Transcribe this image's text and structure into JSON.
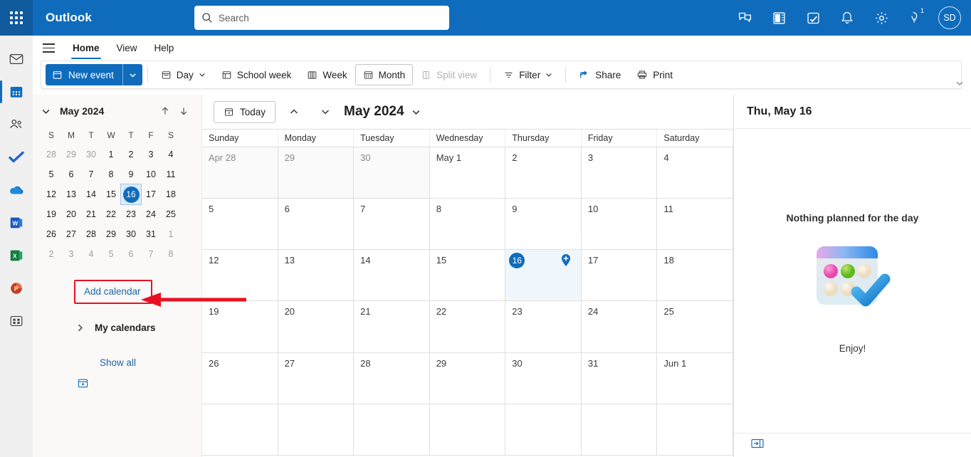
{
  "topbar": {
    "app_grid_icon": "waffle-icon",
    "brand": "Outlook",
    "search_placeholder": "Search",
    "search_value": "",
    "search_icon": "search-icon",
    "icons": [
      {
        "name": "teams-chat-icon",
        "label": "Chat"
      },
      {
        "name": "onenote-icon",
        "label": "OneNote"
      },
      {
        "name": "notes-icon",
        "label": "Notes"
      },
      {
        "name": "bell-icon",
        "label": "Notifications"
      },
      {
        "name": "gear-icon",
        "label": "Settings"
      },
      {
        "name": "feedback-icon",
        "label": "Feedback"
      }
    ],
    "feedback_badge": "1",
    "avatar_initials": "SD",
    "bg_color": "#0f6cbd"
  },
  "rail": {
    "items": [
      {
        "name": "rail-item-mail",
        "label": "Mail",
        "active": false
      },
      {
        "name": "rail-item-calendar",
        "label": "Calendar",
        "active": true
      },
      {
        "name": "rail-item-people",
        "label": "People",
        "active": false
      },
      {
        "name": "rail-item-todo",
        "label": "To Do",
        "active": false
      },
      {
        "name": "rail-item-onedrive",
        "label": "OneDrive",
        "active": false
      },
      {
        "name": "rail-item-word",
        "label": "Word",
        "active": false
      },
      {
        "name": "rail-item-excel",
        "label": "Excel",
        "active": false
      },
      {
        "name": "rail-item-powerpoint",
        "label": "PowerPoint",
        "active": false
      },
      {
        "name": "rail-item-apps",
        "label": "More apps",
        "active": false
      }
    ]
  },
  "tabs": {
    "hamburger_icon": "hamburger-icon",
    "items": [
      {
        "label": "Home",
        "active": true
      },
      {
        "label": "View",
        "active": false
      },
      {
        "label": "Help",
        "active": false
      }
    ]
  },
  "toolbar": {
    "new_event_label": "New event",
    "new_event_caret": "chevron-down-icon",
    "day_label": "Day",
    "school_week_label": "School week",
    "week_label": "Week",
    "month_label": "Month",
    "split_view_label": "Split view",
    "filter_label": "Filter",
    "share_label": "Share",
    "print_label": "Print",
    "ribbon_expand_icon": "chevron-down-icon",
    "selected": "Month",
    "disabled": "Split view"
  },
  "left_pane": {
    "mini_calendar": {
      "title": "May 2024",
      "collapse_icon": "chevron-down-icon",
      "prev_icon": "arrow-up-icon",
      "next_icon": "arrow-down-icon",
      "day_initials": [
        "S",
        "M",
        "T",
        "W",
        "T",
        "F",
        "S"
      ],
      "weeks": [
        [
          {
            "d": "28",
            "out": true
          },
          {
            "d": "29",
            "out": true
          },
          {
            "d": "30",
            "out": true
          },
          {
            "d": "1"
          },
          {
            "d": "2"
          },
          {
            "d": "3"
          },
          {
            "d": "4"
          }
        ],
        [
          {
            "d": "5"
          },
          {
            "d": "6"
          },
          {
            "d": "7"
          },
          {
            "d": "8"
          },
          {
            "d": "9"
          },
          {
            "d": "10"
          },
          {
            "d": "11"
          }
        ],
        [
          {
            "d": "12"
          },
          {
            "d": "13"
          },
          {
            "d": "14"
          },
          {
            "d": "15"
          },
          {
            "d": "16",
            "today": true
          },
          {
            "d": "17"
          },
          {
            "d": "18"
          }
        ],
        [
          {
            "d": "19"
          },
          {
            "d": "20"
          },
          {
            "d": "21"
          },
          {
            "d": "22"
          },
          {
            "d": "23"
          },
          {
            "d": "24"
          },
          {
            "d": "25"
          }
        ],
        [
          {
            "d": "26"
          },
          {
            "d": "27"
          },
          {
            "d": "28"
          },
          {
            "d": "29"
          },
          {
            "d": "30"
          },
          {
            "d": "31"
          },
          {
            "d": "1",
            "out": true
          }
        ],
        [
          {
            "d": "2",
            "out": true
          },
          {
            "d": "3",
            "out": true
          },
          {
            "d": "4",
            "out": true
          },
          {
            "d": "5",
            "out": true
          },
          {
            "d": "6",
            "out": true
          },
          {
            "d": "7",
            "out": true
          },
          {
            "d": "8",
            "out": true
          }
        ]
      ]
    },
    "add_calendar_label": "Add calendar",
    "add_calendar_icon": "calendar-plus-icon",
    "my_calendars_label": "My calendars",
    "my_calendars_icon": "chevron-right-icon",
    "show_all_label": "Show all",
    "highlight_color": "#e81123"
  },
  "calendar": {
    "today_label": "Today",
    "today_icon": "calendar-today-icon",
    "prev_icon": "chevron-up-icon",
    "next_icon": "chevron-down-icon",
    "month_label": "May 2024",
    "month_caret": "chevron-down-icon",
    "day_headers": [
      "Sunday",
      "Monday",
      "Tuesday",
      "Wednesday",
      "Thursday",
      "Friday",
      "Saturday"
    ],
    "weeks": [
      [
        {
          "label": "Apr 28",
          "dim": true
        },
        {
          "label": "29",
          "dim": true
        },
        {
          "label": "30",
          "dim": true
        },
        {
          "label": "May 1"
        },
        {
          "label": "2"
        },
        {
          "label": "3"
        },
        {
          "label": "4"
        }
      ],
      [
        {
          "label": "5"
        },
        {
          "label": "6"
        },
        {
          "label": "7"
        },
        {
          "label": "8"
        },
        {
          "label": "9"
        },
        {
          "label": "10"
        },
        {
          "label": "11"
        }
      ],
      [
        {
          "label": "12"
        },
        {
          "label": "13"
        },
        {
          "label": "14"
        },
        {
          "label": "15"
        },
        {
          "label": "16",
          "selected": true,
          "add_icon": "add-event-pin-icon"
        },
        {
          "label": "17"
        },
        {
          "label": "18"
        }
      ],
      [
        {
          "label": "19"
        },
        {
          "label": "20"
        },
        {
          "label": "21"
        },
        {
          "label": "22"
        },
        {
          "label": "23"
        },
        {
          "label": "24"
        },
        {
          "label": "25"
        }
      ],
      [
        {
          "label": "26"
        },
        {
          "label": "27"
        },
        {
          "label": "28"
        },
        {
          "label": "29"
        },
        {
          "label": "30"
        },
        {
          "label": "31"
        },
        {
          "label": "Jun 1"
        }
      ],
      [
        {
          "label": ""
        },
        {
          "label": ""
        },
        {
          "label": ""
        },
        {
          "label": ""
        },
        {
          "label": ""
        },
        {
          "label": ""
        },
        {
          "label": ""
        }
      ]
    ]
  },
  "agenda": {
    "title": "Thu, May 16",
    "empty_message": "Nothing planned for the day",
    "illustration": "calendar-checkmark-illustration",
    "enjoy_label": "Enjoy!",
    "collapse_icon": "expand-panel-icon"
  }
}
